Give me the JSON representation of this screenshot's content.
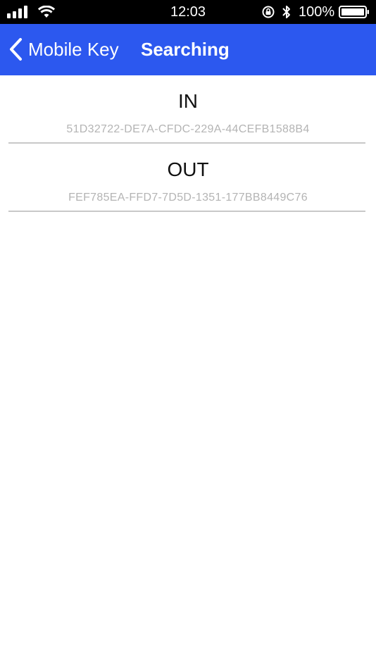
{
  "status_bar": {
    "time": "12:03",
    "battery_percent": "100%",
    "icons": [
      "signal-icon",
      "wifi-icon",
      "rotation-lock-icon",
      "bluetooth-icon",
      "battery-icon"
    ]
  },
  "nav": {
    "back_label": "Mobile Key",
    "title": "Searching",
    "background_color": "#2c58ef"
  },
  "beacons": [
    {
      "name": "IN",
      "uuid": "51D32722-DE7A-CFDC-229A-44CEFB1588B4"
    },
    {
      "name": "OUT",
      "uuid": "FEF785EA-FFD7-7D5D-1351-177BB8449C76"
    }
  ]
}
